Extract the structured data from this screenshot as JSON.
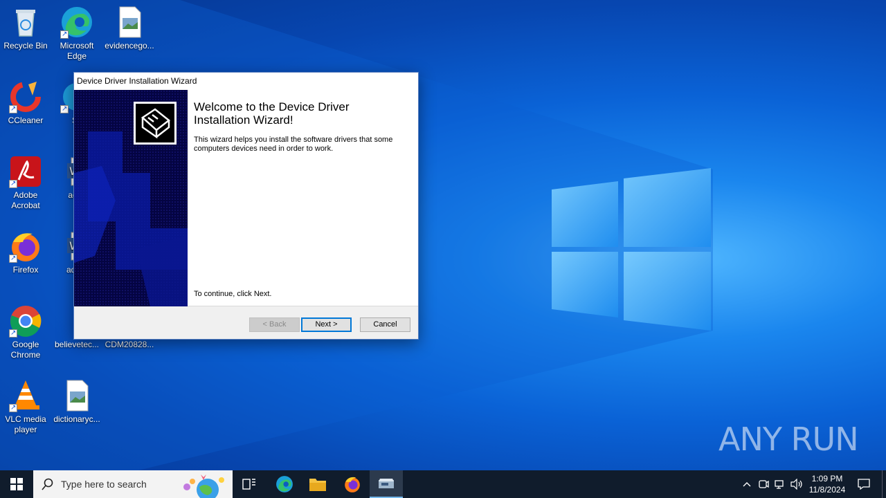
{
  "desktop": {
    "icons": [
      {
        "label": "Recycle Bin"
      },
      {
        "label": "Microsoft Edge"
      },
      {
        "label": "evidencego..."
      },
      {
        "label": "CCleaner"
      },
      {
        "label": "Sk"
      },
      {
        "label": "Adobe Acrobat"
      },
      {
        "label": "actio"
      },
      {
        "label": "Firefox"
      },
      {
        "label": "adver"
      },
      {
        "label": "Google Chrome"
      },
      {
        "label": "believetec..."
      },
      {
        "label": "CDM20828..."
      },
      {
        "label": "VLC media player"
      },
      {
        "label": "dictionaryc..."
      }
    ],
    "watermark": "ANY RUN"
  },
  "dialog": {
    "title": "Device Driver Installation Wizard",
    "heading": "Welcome to the Device Driver Installation Wizard!",
    "description": "This wizard helps you install the software drivers that some computers devices need in order to work.",
    "continue_text": "To continue, click Next.",
    "back_label": "< Back",
    "next_label": "Next >",
    "cancel_label": "Cancel"
  },
  "taskbar": {
    "search_placeholder": "Type here to search",
    "time": "1:09 PM",
    "date": "11/8/2024"
  },
  "colors": {
    "wizard_side": "#040442",
    "default_button_border": "#0078d7",
    "taskbar": "#101c2c"
  }
}
